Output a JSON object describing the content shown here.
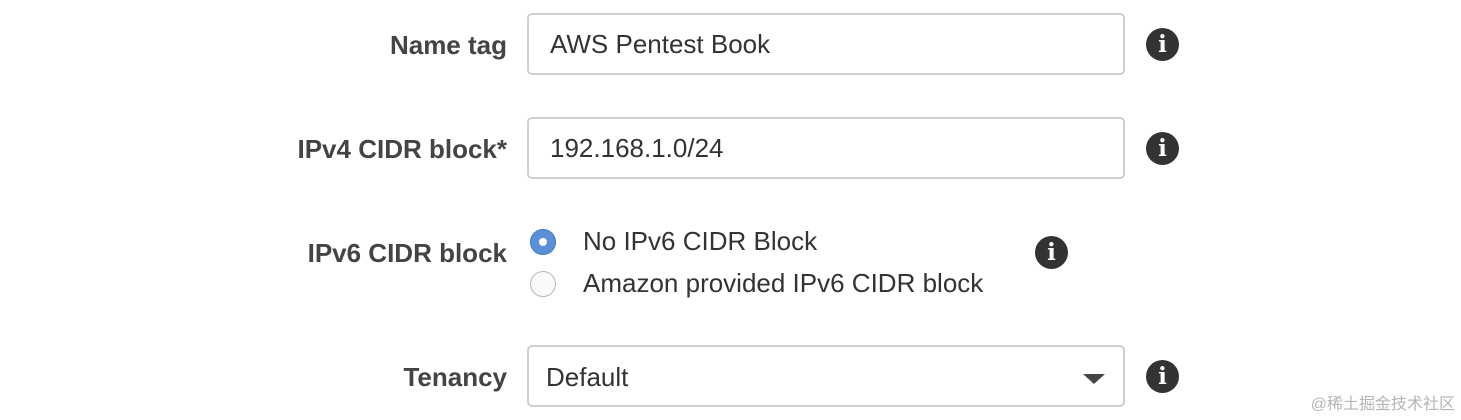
{
  "form": {
    "name_tag": {
      "label": "Name tag",
      "value": "AWS Pentest Book"
    },
    "ipv4_cidr": {
      "label": "IPv4 CIDR block*",
      "value": "192.168.1.0/24"
    },
    "ipv6_cidr": {
      "label": "IPv6 CIDR block",
      "options": [
        {
          "label": "No IPv6 CIDR Block",
          "selected": true
        },
        {
          "label": "Amazon provided IPv6 CIDR block",
          "selected": false
        }
      ]
    },
    "tenancy": {
      "label": "Tenancy",
      "selected": "Default"
    },
    "info_glyph": "i"
  },
  "watermark": "@稀土掘金技术社区",
  "icons": {
    "info": "info-icon",
    "dropdown": "chevron-down-icon"
  },
  "colors": {
    "radio_selected": "#5b8fd6",
    "label_text": "#444444",
    "input_border": "#cfcfcf",
    "info_icon_bg": "#333333"
  }
}
